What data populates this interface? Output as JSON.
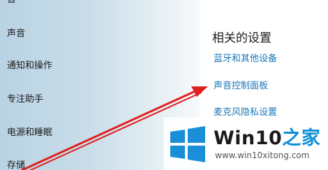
{
  "sidebar": {
    "partial_top": "盲",
    "items": [
      {
        "label": "声音"
      },
      {
        "label": "通知和操作"
      },
      {
        "label": "专注助手"
      },
      {
        "label": "电源和睡眠"
      },
      {
        "label": "存储"
      }
    ]
  },
  "related": {
    "title": "相关的设置",
    "links": [
      {
        "label": "蓝牙和其他设备"
      },
      {
        "label": "声音控制面板"
      },
      {
        "label": "麦克风隐私设置"
      }
    ]
  },
  "watermark": {
    "brand_prefix": "Win10",
    "brand_suffix": "之家",
    "url": "www.win10xitong.com",
    "logo_icon": "windows-logo-icon"
  },
  "colors": {
    "accent_link": "#1977b8",
    "arrow": "#e02020",
    "sidebar_from": "#b9d3e4",
    "sidebar_to": "#f6f9fb",
    "watermark_blue": "#0e8fd6"
  }
}
